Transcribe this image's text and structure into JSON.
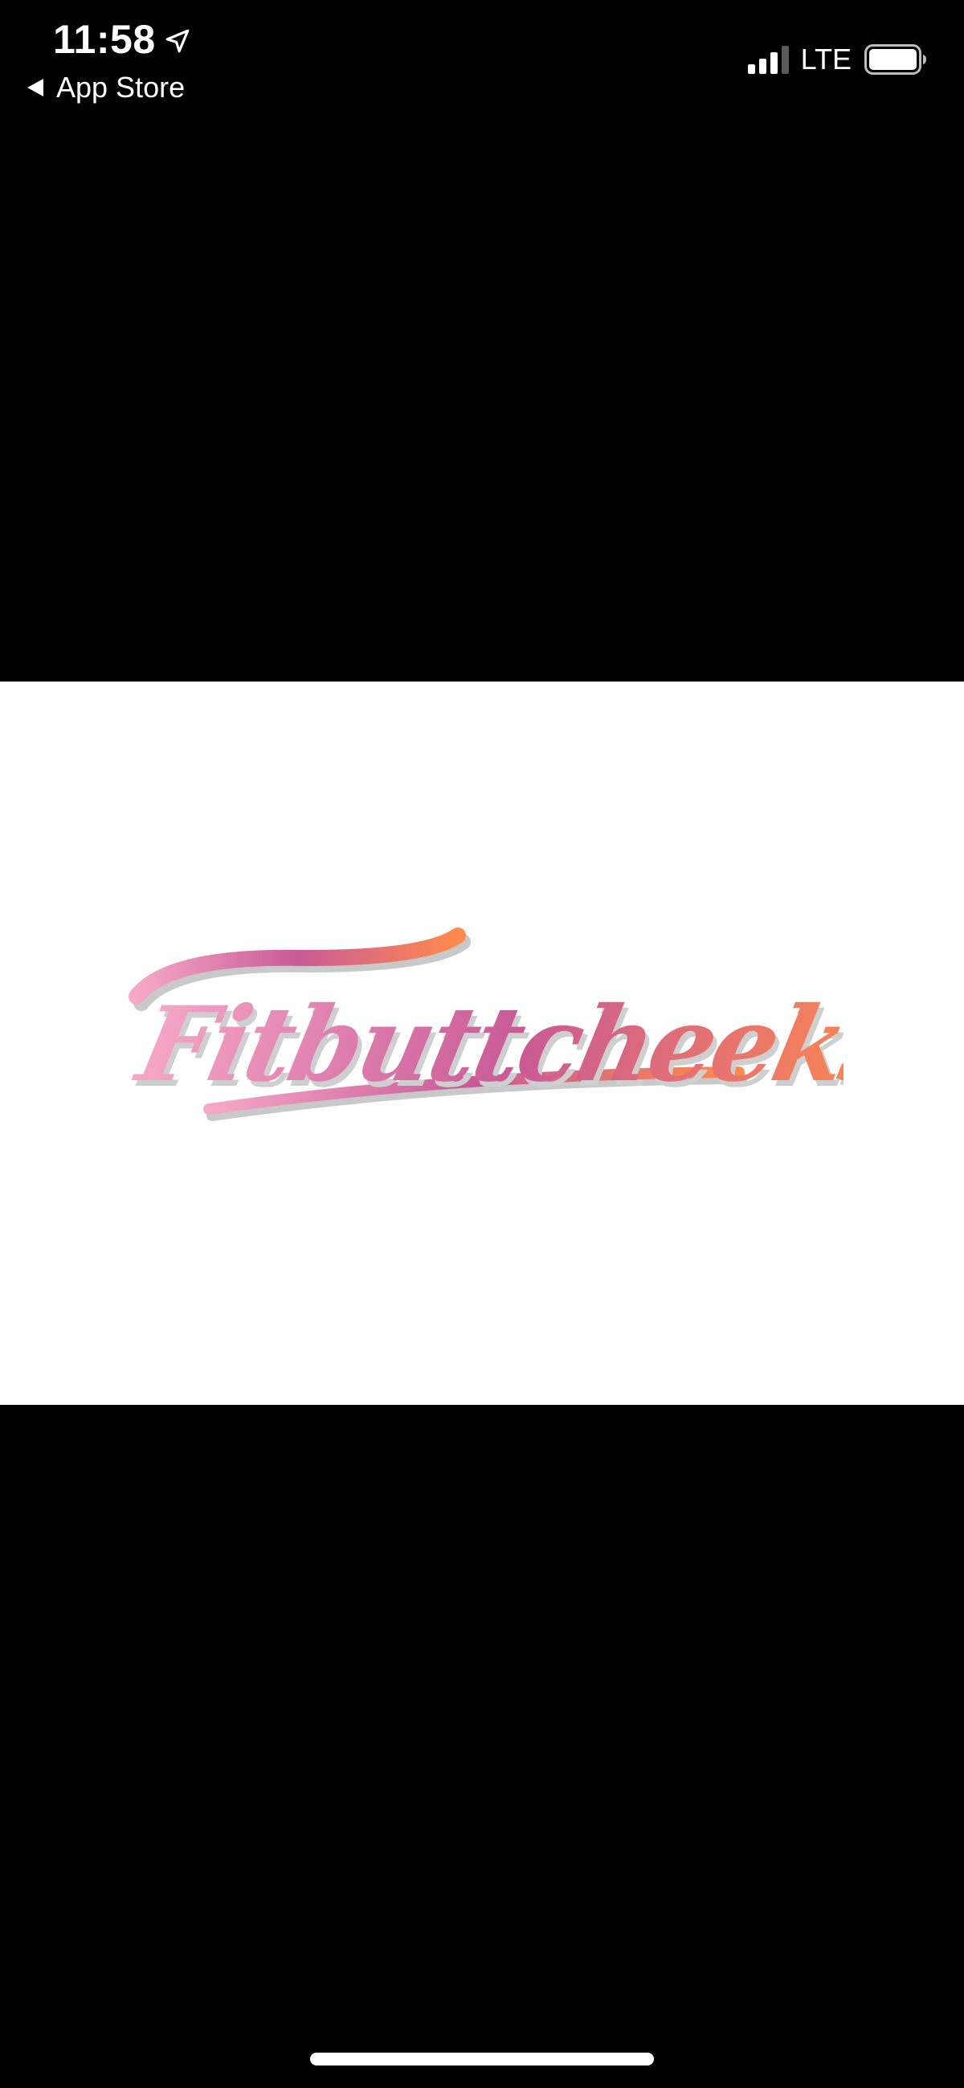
{
  "status_bar": {
    "time": "11:58",
    "back_label": "App Store",
    "network": "LTE",
    "icons": {
      "location": "location-arrow-icon",
      "back": "back-triangle-icon",
      "signal": "cellular-signal-icon",
      "battery": "battery-icon"
    },
    "signal_bars_active": 3,
    "signal_bars_total": 4,
    "battery_level": 1.0
  },
  "content": {
    "logo_text": "Fitbuttcheeks",
    "logo_colors": {
      "gradient_start": "#f6a8c8",
      "gradient_mid": "#c95a97",
      "gradient_end": "#ff8a4c",
      "shadow": "#c9c9c9"
    }
  },
  "colors": {
    "background": "#000000",
    "panel": "#ffffff",
    "foreground": "#ffffff"
  }
}
